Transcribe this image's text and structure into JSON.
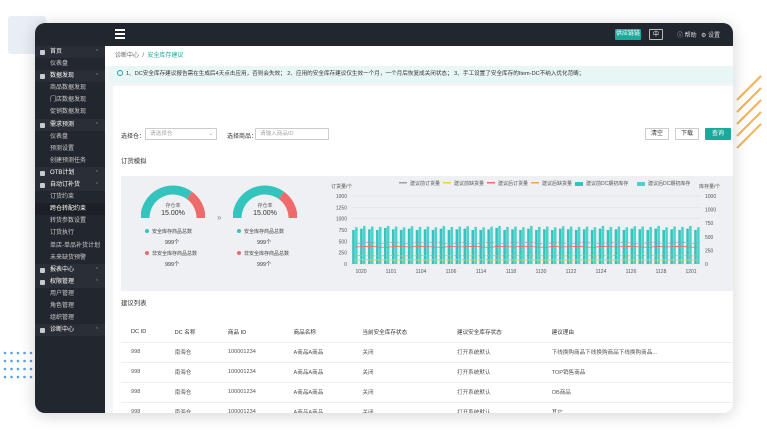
{
  "topbar": {
    "admin_label": "供应链链",
    "lang": "中",
    "help": "帮助",
    "settings": "设置"
  },
  "sidebar": {
    "items": [
      {
        "label": "首页",
        "type": "grp"
      },
      {
        "label": "仪表盘",
        "type": "sub"
      },
      {
        "label": "数据发现",
        "type": "grp"
      },
      {
        "label": "商品数据发现",
        "type": "sub"
      },
      {
        "label": "门店数据发现",
        "type": "sub"
      },
      {
        "label": "促销数据发现",
        "type": "sub"
      },
      {
        "label": "需求预测",
        "type": "grp"
      },
      {
        "label": "仪表盘",
        "type": "sub"
      },
      {
        "label": "预测设置",
        "type": "sub"
      },
      {
        "label": "创建预测任务",
        "type": "sub"
      },
      {
        "label": "OTB计划",
        "type": "grp"
      },
      {
        "label": "自动订补货",
        "type": "grp"
      },
      {
        "label": "订货约束",
        "type": "sub"
      },
      {
        "label": "跨仓转配约束",
        "type": "active"
      },
      {
        "label": "转货参数设置",
        "type": "sub"
      },
      {
        "label": "订货执行",
        "type": "sub"
      },
      {
        "label": "单店-单品补货计划",
        "type": "sub"
      },
      {
        "label": "未来缺货预警",
        "type": "sub"
      },
      {
        "label": "报表中心",
        "type": "grp"
      },
      {
        "label": "权限管理",
        "type": "grp"
      },
      {
        "label": "用户管理",
        "type": "sub"
      },
      {
        "label": "角色管理",
        "type": "sub"
      },
      {
        "label": "组织管理",
        "type": "sub"
      },
      {
        "label": "诊断中心",
        "type": "grp"
      }
    ]
  },
  "breadcrumb": {
    "root": "诊断中心",
    "sep": "/",
    "current": "安全库存建议"
  },
  "notice": "1、DC安全库存建议报告需在生成后4天点击应用，否则会失效；  2、应用的安全库存建议仅生效一个月，一个月后恢复成关闭状态；  3、手工设置了安全库存的Item-DC不纳入优化范畴；",
  "filters": {
    "warehouse_label": "选择仓：",
    "warehouse_placeholder": "请选择仓",
    "product_label": "选择商品：",
    "product_placeholder": "请输入商品ID",
    "clear": "清空",
    "download": "下载",
    "query": "查询"
  },
  "sim_title": "订货模拟",
  "gauges": [
    {
      "label": "存仓率",
      "pct": "15.00%",
      "r1": "安全库存商品总数",
      "v1": "999个",
      "r2": "非安全库存商品总数",
      "v2": "999个",
      "fill": 0.7
    },
    {
      "label": "存仓率",
      "pct": "15.00%",
      "r1": "安全库存商品总数",
      "v1": "999个",
      "r2": "非安全库存商品总数",
      "v2": "999个",
      "fill": 0.7
    }
  ],
  "arrow": "»",
  "chart_data": {
    "type": "bar",
    "ylabel_left": "订货量/个",
    "ylabel_right": "库存量/个",
    "yticks": [
      "1000",
      "1250",
      "1000",
      "750",
      "500",
      "250",
      "0"
    ],
    "yticks_right": [
      "1000",
      "1000",
      "750",
      "500",
      "250",
      "0"
    ],
    "xticks": [
      "1020",
      "1101",
      "1104",
      "1106",
      "1114",
      "1118",
      "1130",
      "1122",
      "1124",
      "1126",
      "1128",
      "1201"
    ],
    "legend": [
      "建议前订货量",
      "建议前缺货量",
      "建议后订货量",
      "建议后缺货量",
      "建议前DC期初库存",
      "建议后DC期初库存"
    ],
    "colors": {
      "teal": "#33c4bd",
      "cyan": "#4dd2cc",
      "red": "#ef6b6b",
      "orange": "#f5a04a",
      "gray": "#9aa0aa",
      "gold": "#f2c94c"
    },
    "bars_a": [
      500,
      520,
      510,
      500,
      530,
      510,
      500,
      520,
      500,
      510,
      500,
      520,
      500,
      510,
      520,
      500,
      500,
      510,
      530,
      500,
      510,
      500,
      520,
      500,
      510,
      500,
      520,
      510,
      500,
      510,
      500,
      520,
      500,
      510,
      500,
      520,
      510,
      500,
      520,
      500,
      510,
      500,
      520,
      500
    ],
    "bars_b": [
      540,
      560,
      550,
      545,
      560,
      550,
      540,
      555,
      545,
      550,
      540,
      560,
      545,
      550,
      555,
      545,
      540,
      550,
      560,
      545,
      550,
      540,
      560,
      545,
      550,
      540,
      555,
      550,
      545,
      550,
      540,
      560,
      545,
      550,
      540,
      555,
      550,
      545,
      560,
      540,
      550,
      545,
      560,
      540
    ],
    "line1": [
      300,
      310,
      320,
      300,
      310,
      320,
      300,
      305,
      315,
      310,
      320,
      305,
      300,
      315,
      310,
      300,
      310,
      320,
      300,
      305,
      315,
      310,
      320,
      305,
      300,
      315,
      310,
      300,
      310,
      320,
      300,
      305,
      315,
      310,
      320,
      305,
      300,
      315,
      310,
      300,
      310,
      320,
      305,
      300
    ],
    "line2": [
      250,
      255,
      260,
      250,
      245,
      260,
      255,
      250,
      260,
      255,
      250,
      245,
      260,
      250,
      255,
      260,
      250,
      245,
      260,
      255,
      250,
      260,
      255,
      250,
      245,
      260,
      250,
      255,
      260,
      250,
      245,
      260,
      255,
      250,
      260,
      255,
      250,
      245,
      260,
      250,
      255,
      260,
      250,
      245
    ],
    "line3": [
      120,
      125,
      118,
      122,
      120,
      125,
      118,
      122,
      120,
      125,
      118,
      122,
      120,
      125,
      118,
      122,
      120,
      125,
      118,
      122,
      120,
      125,
      118,
      122,
      120,
      125,
      118,
      122,
      120,
      125,
      118,
      122,
      120,
      125,
      118,
      122,
      120,
      125,
      118,
      122,
      120,
      125,
      118,
      122
    ],
    "line4": [
      60,
      62,
      58,
      60,
      62,
      58,
      60,
      62,
      58,
      60,
      62,
      58,
      60,
      62,
      58,
      60,
      62,
      58,
      60,
      62,
      58,
      60,
      62,
      58,
      60,
      62,
      58,
      60,
      62,
      58,
      60,
      62,
      58,
      60,
      62,
      58,
      60,
      62,
      58,
      60,
      62,
      58,
      60,
      62
    ],
    "ylim": [
      0,
      1000
    ]
  },
  "table_title": "建议列表",
  "table": {
    "headers": [
      "DC ID",
      "DC 名称",
      "商品 ID",
      "商品名称",
      "当前安全库存状态",
      "建议安全库存状态",
      "建议理由"
    ],
    "rows": [
      [
        "998",
        "南海仓",
        "100001234",
        "A商品A商品",
        "关闭",
        "打开系统默认",
        "下线换购商品下线换购商品下线换购商品..."
      ],
      [
        "998",
        "南海仓",
        "100001234",
        "A商品A商品",
        "关闭",
        "打开系统默认",
        "TOP销售商品"
      ],
      [
        "998",
        "南海仓",
        "100001234",
        "A商品A商品",
        "关闭",
        "打开系统默认",
        "OB商品"
      ],
      [
        "998",
        "南海仓",
        "100001234",
        "A商品A商品",
        "关闭",
        "打开系统默认",
        "其它"
      ]
    ]
  }
}
